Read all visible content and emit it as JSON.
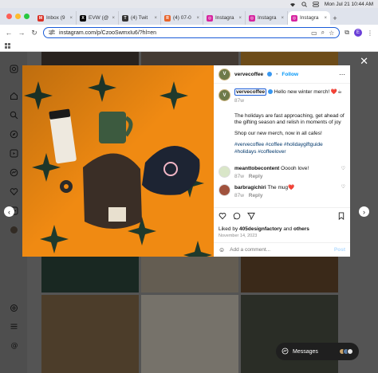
{
  "menubar": {
    "datetime": "Mon Jul 21  10:44 AM"
  },
  "tabs": [
    {
      "label": "Inbox (9",
      "favicon_color": "#d93025",
      "favicon_text": "M"
    },
    {
      "label": "EVW (@",
      "favicon_color": "#000000",
      "favicon_text": "X"
    },
    {
      "label": "(4) Twit",
      "favicon_color": "#333333",
      "favicon_text": "T"
    },
    {
      "label": "(4) 07-0",
      "favicon_color": "#e8642b",
      "favicon_text": "R"
    },
    {
      "label": "Instagra",
      "favicon_color": "#d6249f",
      "favicon_text": "◎"
    },
    {
      "label": "Instagra",
      "favicon_color": "#d6249f",
      "favicon_text": "◎"
    },
    {
      "label": "Instagra",
      "favicon_color": "#d6249f",
      "favicon_text": "◎"
    }
  ],
  "toolbar": {
    "url": "instagram.com/p/CzooSwmxIu6/?hl=en",
    "profile_initial": "E"
  },
  "post": {
    "username": "vervecoffee",
    "follow_label": "Follow",
    "caption_intro": "Hello new winter merch! ❤️☕",
    "caption_age": "87w",
    "caption_p1": "The holidays are fast approaching, get ahead of the gifting season and relish in moments of joy",
    "caption_p2": "Shop our new merch, now in all cafes!",
    "hashtags": "#vervecoffee #coffee #holidaygiftguide #holidays #coffeelover",
    "comments": [
      {
        "user": "meanttobecontent",
        "text": "Ooooh love!",
        "age": "87w",
        "reply": "Reply"
      },
      {
        "user": "barbragichiri",
        "text": "The mug❤️",
        "age": "87w",
        "reply": "Reply"
      }
    ],
    "liked_by_prefix": "Liked by",
    "liked_by_user": "405designfactory",
    "liked_by_and": "and",
    "liked_by_others": "others",
    "date": "November 14, 2023",
    "add_comment_placeholder": "Add a comment...",
    "post_label": "Post"
  },
  "messages": {
    "label": "Messages"
  },
  "colors": {
    "accent": "#0095f6",
    "photo_bg": "#f08a12"
  }
}
